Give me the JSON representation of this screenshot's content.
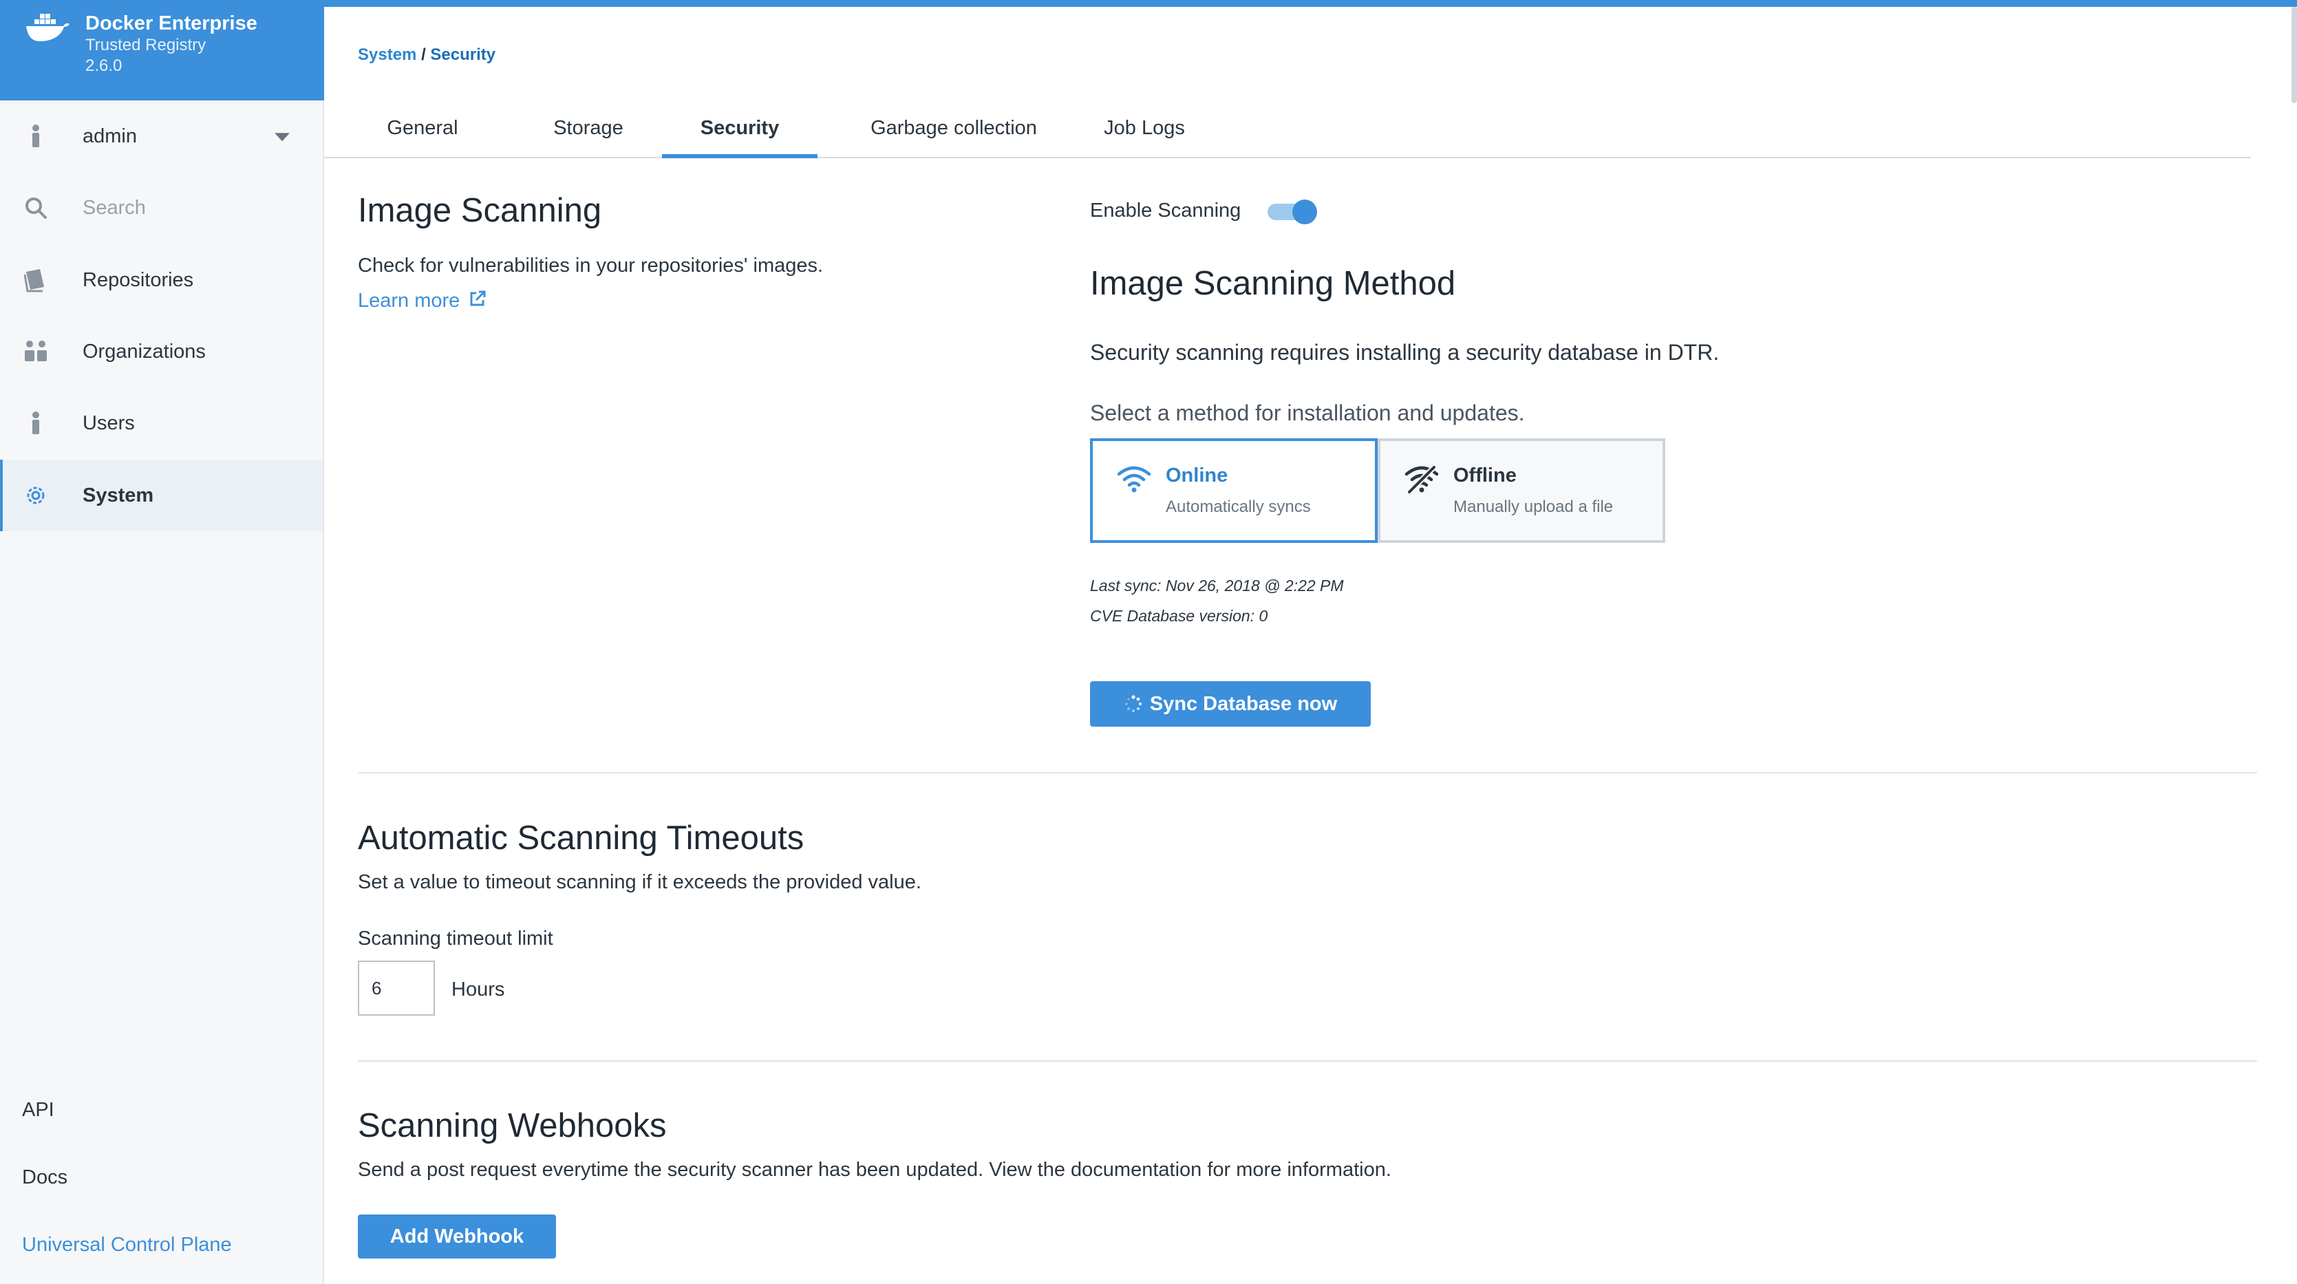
{
  "brand": {
    "title": "Docker Enterprise",
    "subtitle": "Trusted Registry",
    "version": "2.6.0"
  },
  "sidebar": {
    "user": "admin",
    "search_placeholder": "Search",
    "items": [
      {
        "label": "Repositories",
        "icon": "repositories-icon"
      },
      {
        "label": "Organizations",
        "icon": "organizations-icon"
      },
      {
        "label": "Users",
        "icon": "user-icon"
      },
      {
        "label": "System",
        "icon": "gear-icon",
        "active": true
      }
    ],
    "footer": {
      "api": "API",
      "docs": "Docs",
      "ucp": "Universal Control Plane"
    }
  },
  "breadcrumb": {
    "parent": "System",
    "separator": "/",
    "current": "Security"
  },
  "tabs": [
    {
      "label": "General"
    },
    {
      "label": "Storage"
    },
    {
      "label": "Security",
      "active": true
    },
    {
      "label": "Garbage collection"
    },
    {
      "label": "Job Logs"
    }
  ],
  "image_scanning": {
    "title": "Image Scanning",
    "description": "Check for vulnerabilities in your repositories' images.",
    "learn_more": "Learn more",
    "enable_label": "Enable Scanning",
    "enabled": true
  },
  "scan_method": {
    "title": "Image Scanning Method",
    "description": "Security scanning requires installing a security database in DTR.",
    "select_prompt": "Select a method for installation and updates.",
    "options": [
      {
        "title": "Online",
        "subtitle": "Automatically syncs",
        "icon": "wifi-icon",
        "selected": true
      },
      {
        "title": "Offline",
        "subtitle": "Manually upload a file",
        "icon": "wifi-off-icon",
        "selected": false
      }
    ],
    "last_sync": "Last sync: Nov 26, 2018 @ 2:22 PM",
    "cve_version": "CVE Database version: 0",
    "sync_button": "Sync Database now"
  },
  "timeouts": {
    "title": "Automatic Scanning Timeouts",
    "description": "Set a value to timeout scanning if it exceeds the provided value.",
    "field_label": "Scanning timeout limit",
    "value": "6",
    "unit": "Hours"
  },
  "webhooks": {
    "title": "Scanning Webhooks",
    "description": "Send a post request everytime the security scanner has been updated. View the documentation for more information.",
    "add_button": "Add Webhook"
  },
  "colors": {
    "accent": "#3c8fdb",
    "sidebar_bg": "#f6f7f8",
    "text": "#2b3640"
  }
}
